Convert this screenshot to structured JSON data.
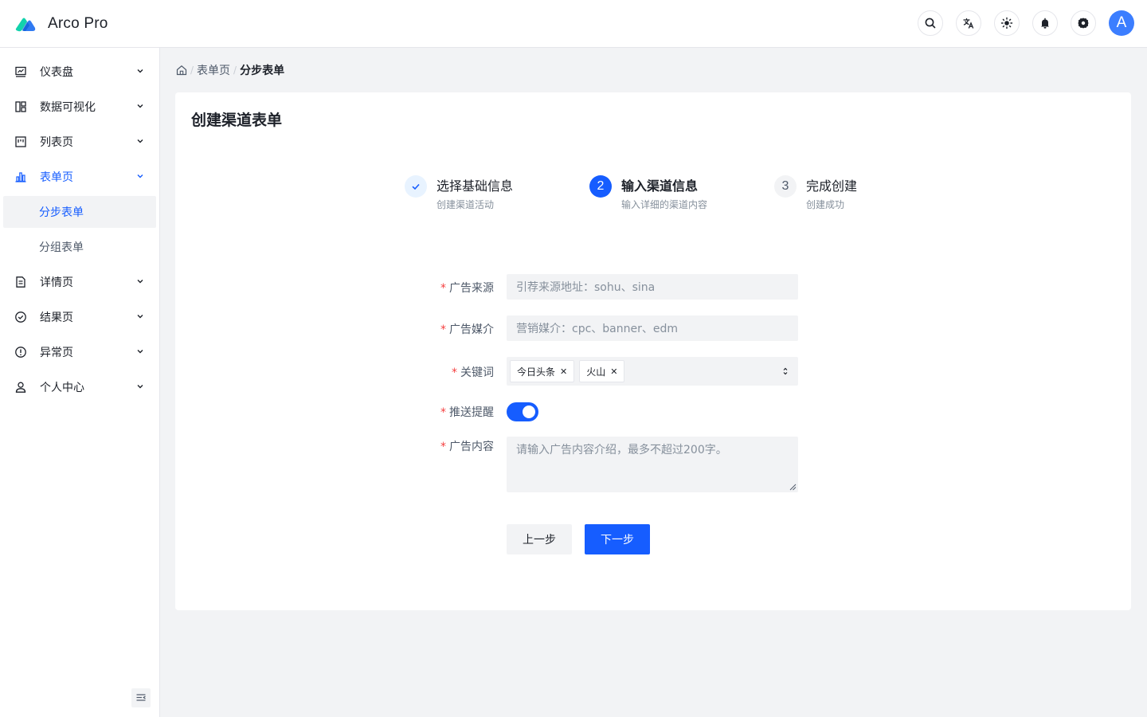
{
  "app": {
    "brand": "Arco Pro",
    "avatar_letter": "A"
  },
  "header": {
    "actions": [
      "search-icon",
      "translate-icon",
      "theme-icon",
      "bell-icon",
      "settings-icon"
    ]
  },
  "sidebar": {
    "items": [
      {
        "label": "仪表盘",
        "icon": "dashboard-icon"
      },
      {
        "label": "数据可视化",
        "icon": "layout-icon"
      },
      {
        "label": "列表页",
        "icon": "list-icon"
      },
      {
        "label": "表单页",
        "icon": "bar-chart-icon"
      },
      {
        "label": "详情页",
        "icon": "file-icon"
      },
      {
        "label": "结果页",
        "icon": "check-circle-icon"
      },
      {
        "label": "异常页",
        "icon": "exclamation-circle-icon"
      },
      {
        "label": "个人中心",
        "icon": "user-icon"
      }
    ],
    "subitems": [
      {
        "label": "分步表单"
      },
      {
        "label": "分组表单"
      }
    ]
  },
  "breadcrumb": {
    "level1": "表单页",
    "current": "分步表单",
    "sep": "/"
  },
  "card": {
    "title": "创建渠道表单"
  },
  "steps": [
    {
      "number": "1",
      "title": "选择基础信息",
      "desc": "创建渠道活动"
    },
    {
      "number": "2",
      "title": "输入渠道信息",
      "desc": "输入详细的渠道内容"
    },
    {
      "number": "3",
      "title": "完成创建",
      "desc": "创建成功"
    }
  ],
  "form": {
    "source": {
      "label": "广告来源",
      "placeholder": "引荐来源地址：sohu、sina"
    },
    "media": {
      "label": "广告媒介",
      "placeholder": "营销媒介：cpc、banner、edm"
    },
    "keywords": {
      "label": "关键词",
      "tags": [
        "今日头条",
        "火山"
      ]
    },
    "remind": {
      "label": "推送提醒",
      "value": true
    },
    "content": {
      "label": "广告内容",
      "placeholder": "请输入广告内容介绍，最多不超过200字。"
    },
    "required_mark": "*"
  },
  "buttons": {
    "prev": "上一步",
    "next": "下一步"
  },
  "colors": {
    "primary": "#165dff",
    "required": "#f53f3f",
    "bg": "#f2f3f5"
  }
}
